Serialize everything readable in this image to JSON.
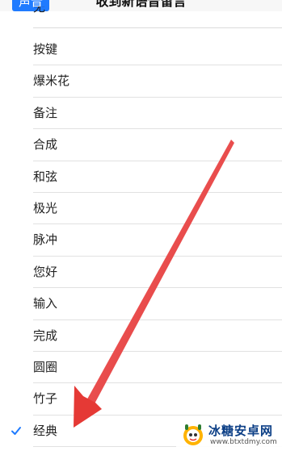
{
  "nav": {
    "back_label": "声音",
    "title": "收到新语音留言"
  },
  "cut_row": {
    "label": "无"
  },
  "tones": [
    {
      "label": "按键",
      "selected": false
    },
    {
      "label": "爆米花",
      "selected": false
    },
    {
      "label": "备注",
      "selected": false
    },
    {
      "label": "合成",
      "selected": false
    },
    {
      "label": "和弦",
      "selected": false
    },
    {
      "label": "极光",
      "selected": false
    },
    {
      "label": "脉冲",
      "selected": false
    },
    {
      "label": "您好",
      "selected": false
    },
    {
      "label": "输入",
      "selected": false
    },
    {
      "label": "完成",
      "selected": false
    },
    {
      "label": "圆圈",
      "selected": false
    },
    {
      "label": "竹子",
      "selected": false
    },
    {
      "label": "经典",
      "selected": true
    }
  ],
  "colors": {
    "accent": "#1f7bff",
    "arrow": "#e53935",
    "watermark_text": "#0c3f86"
  },
  "icons": {
    "check": "check-icon",
    "annotation": "red-arrow-icon",
    "logo": "watermark-logo-icon"
  },
  "watermark": {
    "title": "冰糖安卓网",
    "url": "www.btxtdmy.com"
  }
}
